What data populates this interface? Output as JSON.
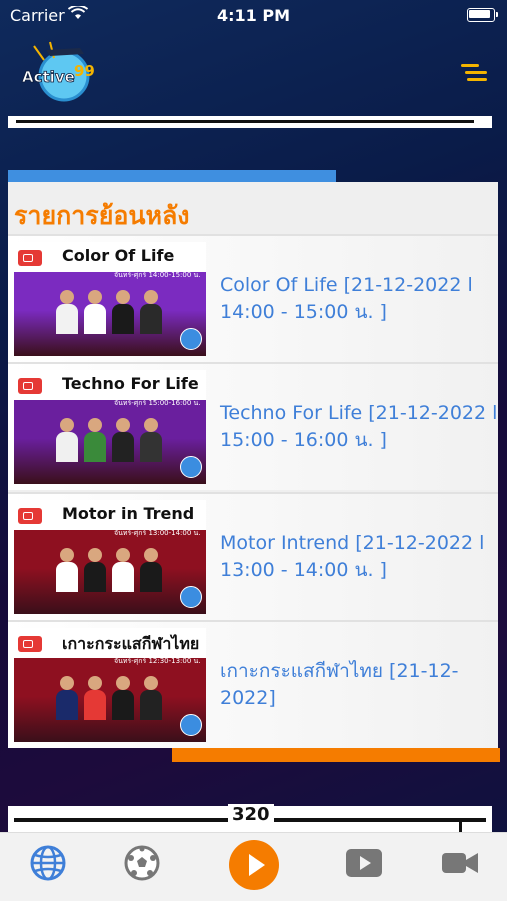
{
  "status_bar": {
    "carrier": "Carrier",
    "time": "4:11 PM"
  },
  "header": {
    "logo_text": "Active99",
    "menu_icon": "menu-icon"
  },
  "section": {
    "title": "รายการย้อนหลัง",
    "items": [
      {
        "thumb_title": "Color Of Life",
        "thumb_schedule": "จันทร์-ศุกร์ 14:00-15:00 น.",
        "thumb_color": "#7b2bc0",
        "label": "Color Of Life [21-12-2022 l 14:00 - 15:00 น. ]"
      },
      {
        "thumb_title": "Techno For Life",
        "thumb_schedule": "จันทร์-ศุกร์ 15:00-16:00 น.",
        "thumb_color": "#6a1f9e",
        "label": "Techno For Life [21-12-2022 l 15:00 - 16:00 น. ]"
      },
      {
        "thumb_title": "Motor in Trend",
        "thumb_schedule": "จันทร์-ศุกร์ 13:00-14:00 น.",
        "thumb_color": "#8e1020",
        "label": "Motor Intrend [21-12-2022 l 13:00 - 14:00 น. ]"
      },
      {
        "thumb_title": "เกาะกระแสกีฬาไทย",
        "thumb_schedule": "จันทร์-ศุกร์ 12:30-13:00 น.",
        "thumb_color": "#8e1020",
        "label": "เกาะกระแสกีฬาไทย [21-12-2022]"
      }
    ]
  },
  "bottom_banner": {
    "number": "320"
  },
  "tabbar": {
    "tabs": [
      "globe-icon",
      "soccer-ball-icon",
      "play-icon",
      "video-icon",
      "camera-icon"
    ],
    "active_color": "#3f7fd8",
    "play_color": "#f57c00"
  }
}
